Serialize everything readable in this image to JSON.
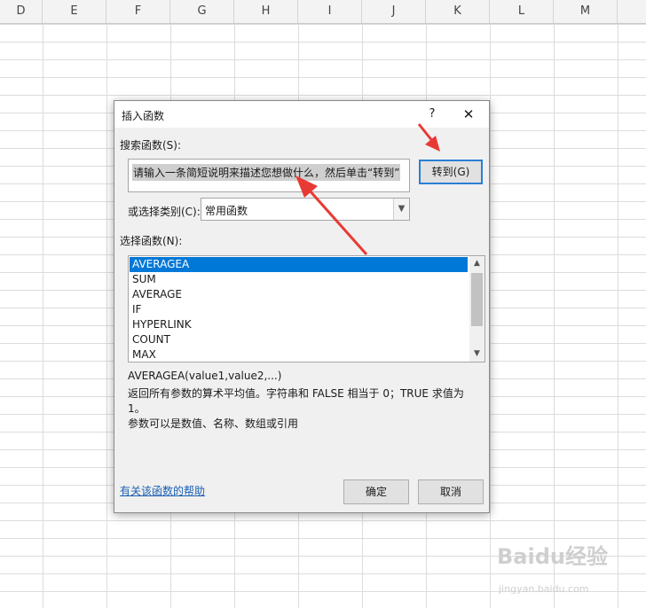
{
  "spreadsheet": {
    "columns": [
      "D",
      "E",
      "F",
      "G",
      "H",
      "I",
      "J",
      "K",
      "L",
      "M"
    ]
  },
  "dialog": {
    "title": "插入函数",
    "help_icon": "?",
    "close_icon": "✕",
    "search_label": "搜索函数(S):",
    "search_value": "请输入一条简短说明来描述您想做什么，然后单击“转到”",
    "goto_button": "转到(G)",
    "category_label": "或选择类别(C):",
    "category_value": "常用函数",
    "function_label": "选择函数(N):",
    "functions": [
      "AVERAGEA",
      "SUM",
      "AVERAGE",
      "IF",
      "HYPERLINK",
      "COUNT",
      "MAX"
    ],
    "selected_index": 0,
    "signature": "AVERAGEA(value1,value2,...)",
    "description_line1": "返回所有参数的算术平均值。字符串和 FALSE 相当于 0；TRUE 求值为 1。",
    "description_line2": "参数可以是数值、名称、数组或引用",
    "help_link": "有关该函数的帮助",
    "ok_button": "确定",
    "cancel_button": "取消"
  },
  "colors": {
    "selection": "#0078d7",
    "arrow": "#e83a35",
    "focus_border": "#2a7fd4"
  },
  "watermark": {
    "text": "Baidu经验",
    "subtext": "jingyan.baidu.com"
  }
}
